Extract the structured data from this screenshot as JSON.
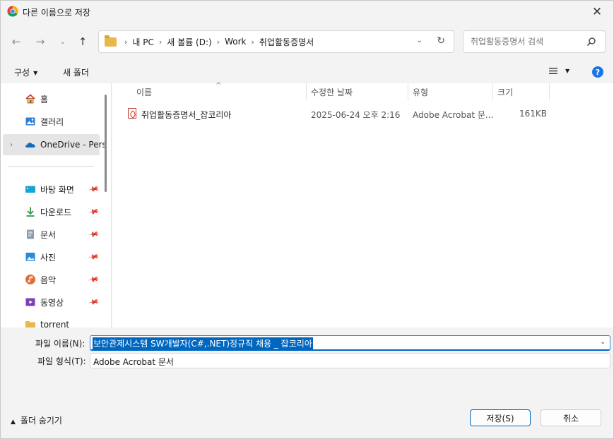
{
  "window": {
    "title": "다른 이름으로 저장"
  },
  "address": {
    "crumbs": [
      "내 PC",
      "새 볼륨 (D:)",
      "Work",
      "취업활동증명서"
    ]
  },
  "search": {
    "placeholder": "취업활동증명서 검색"
  },
  "toolbar": {
    "organize_label": "구성",
    "new_folder_label": "새 폴더"
  },
  "nav": {
    "items": [
      {
        "label": "홈",
        "icon": "home-icon"
      },
      {
        "label": "갤러리",
        "icon": "gallery-icon"
      },
      {
        "label": "OneDrive - Pers",
        "icon": "onedrive-icon"
      },
      {
        "label": "바탕 화면",
        "icon": "desktop-icon"
      },
      {
        "label": "다운로드",
        "icon": "download-icon"
      },
      {
        "label": "문서",
        "icon": "document-icon"
      },
      {
        "label": "사진",
        "icon": "pictures-icon"
      },
      {
        "label": "음악",
        "icon": "music-icon"
      },
      {
        "label": "동영상",
        "icon": "video-icon"
      },
      {
        "label": "torrent",
        "icon": "folder-icon"
      }
    ]
  },
  "columns": {
    "name": "이름",
    "modified": "수정한 날짜",
    "type": "유형",
    "size": "크기"
  },
  "files": [
    {
      "name": "취업활동증명서_잡코리아",
      "modified": "2025-06-24 오후 2:16",
      "type": "Adobe Acrobat 문...",
      "size": "161KB"
    }
  ],
  "form": {
    "filename_label": "파일 이름(N):",
    "filename_value": "보안관제시스템 SW개발자(C#,.NET)정규직 채용 _ 잡코리아",
    "filetype_label": "파일 형식(T):",
    "filetype_value": "Adobe Acrobat 문서"
  },
  "footer": {
    "hide_folders_label": "폴더 숨기기",
    "save_label": "저장(S)",
    "cancel_label": "취소"
  },
  "colors": {
    "accent": "#0067c0",
    "help": "#1a73e8",
    "pdf": "#d0281b",
    "folder": "#e8b84a"
  }
}
